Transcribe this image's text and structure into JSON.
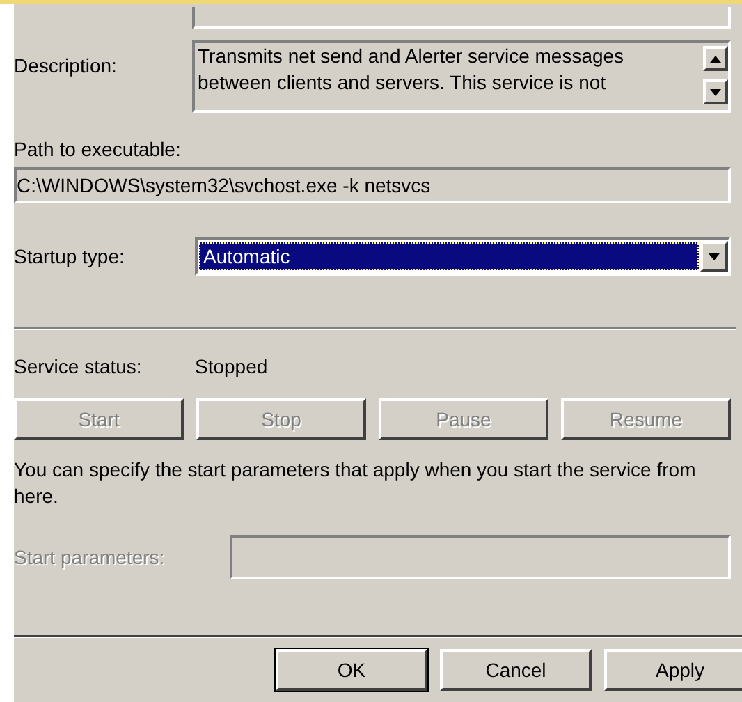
{
  "description": {
    "label": "Description:",
    "text": "Transmits net send and Alerter service messages between clients and servers. This service is not"
  },
  "path": {
    "label": "Path to executable:",
    "value": "C:\\WINDOWS\\system32\\svchost.exe -k netsvcs"
  },
  "startup_type": {
    "label": "Startup type:",
    "value": "Automatic",
    "focused": true
  },
  "service_status": {
    "label": "Service status:",
    "value": "Stopped"
  },
  "service_buttons": [
    {
      "label": "Start",
      "disabled": true
    },
    {
      "label": "Stop",
      "disabled": true
    },
    {
      "label": "Pause",
      "disabled": true
    },
    {
      "label": "Resume",
      "disabled": true
    }
  ],
  "hint": "You can specify the start parameters that apply when you start the service from here.",
  "start_parameters": {
    "label": "Start parameters:",
    "disabled": true
  },
  "dialog_buttons": [
    {
      "label": "OK",
      "default": true
    },
    {
      "label": "Cancel",
      "default": false
    },
    {
      "label": "Apply",
      "default": false
    }
  ]
}
